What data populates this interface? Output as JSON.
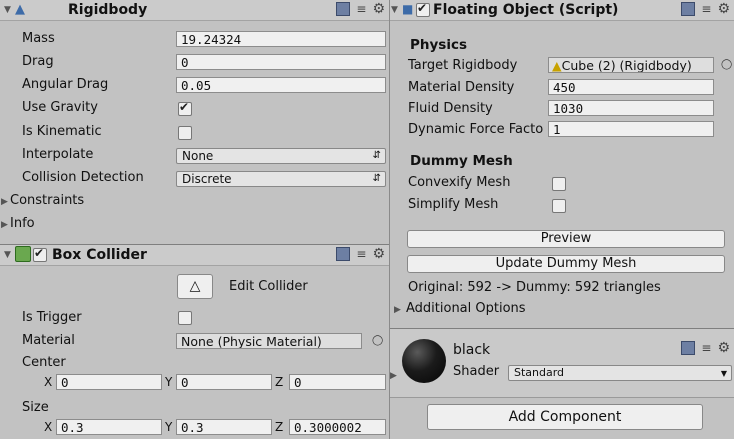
{
  "rigidbody": {
    "title": "Rigidbody",
    "mass_label": "Mass",
    "mass": "19.24324",
    "drag_label": "Drag",
    "drag": "0",
    "angular_drag_label": "Angular Drag",
    "angular_drag": "0.05",
    "use_gravity_label": "Use Gravity",
    "use_gravity": true,
    "is_kinematic_label": "Is Kinematic",
    "is_kinematic": false,
    "interpolate_label": "Interpolate",
    "interpolate": "None",
    "collision_label": "Collision Detection",
    "collision": "Discrete",
    "constraints_label": "Constraints",
    "info_label": "Info"
  },
  "box_collider": {
    "title": "Box Collider",
    "enabled": true,
    "edit_collider_label": "Edit Collider",
    "is_trigger_label": "Is Trigger",
    "is_trigger": false,
    "material_label": "Material",
    "material": "None (Physic Material)",
    "center_label": "Center",
    "center": {
      "x": "0",
      "y": "0",
      "z": "0"
    },
    "size_label": "Size",
    "size": {
      "x": "0.3",
      "y": "0.3",
      "z": "0.3000002"
    },
    "axis_x": "X",
    "axis_y": "Y",
    "axis_z": "Z"
  },
  "floating_object": {
    "title": "Floating Object (Script)",
    "enabled": true,
    "physics_header": "Physics",
    "target_rigidbody_label": "Target Rigidbody",
    "target_rigidbody": "Cube (2) (Rigidbody)",
    "material_density_label": "Material Density",
    "material_density": "450",
    "fluid_density_label": "Fluid Density",
    "fluid_density": "1030",
    "dynamic_force_label": "Dynamic Force Facto",
    "dynamic_force": "1",
    "dummy_mesh_header": "Dummy Mesh",
    "convexify_label": "Convexify Mesh",
    "convexify": false,
    "simplify_label": "Simplify Mesh",
    "simplify": false,
    "preview_button": "Preview",
    "update_button": "Update Dummy Mesh",
    "summary": "Original: 592 -> Dummy: 592 triangles",
    "additional_options": "Additional Options"
  },
  "material_block": {
    "name": "black",
    "shader_label": "Shader",
    "shader": "Standard"
  },
  "add_component_button": "Add Component",
  "colors": {
    "panel_bg": "#c2c2c2",
    "field_bg": "#f0f0f0",
    "accent": "#3d6ba8"
  }
}
